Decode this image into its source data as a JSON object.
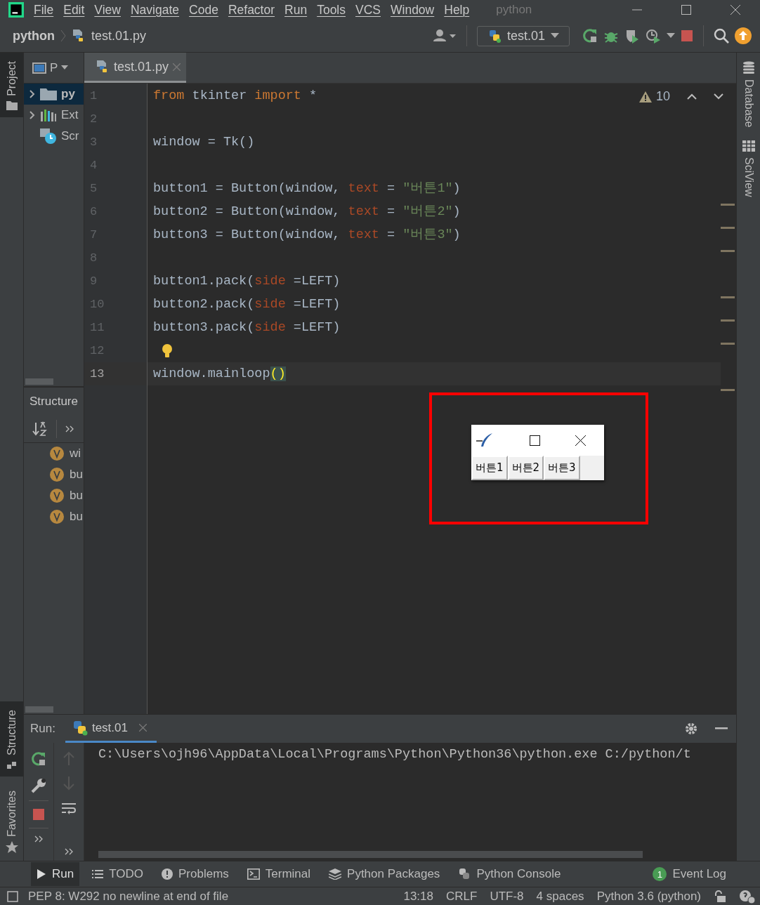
{
  "menu_bar": {
    "items": [
      "File",
      "Edit",
      "View",
      "Navigate",
      "Code",
      "Refactor",
      "Run",
      "Tools",
      "VCS",
      "Window",
      "Help"
    ],
    "project_title": "python"
  },
  "nav_bar": {
    "breadcrumbs": [
      "python",
      "test.01.py"
    ],
    "run_config": "test.01"
  },
  "side_tabs": {
    "left_top": [
      {
        "label": "Project",
        "selected": true
      }
    ],
    "left_bottom": [
      {
        "label": "Structure",
        "selected": true
      },
      {
        "label": "Favorites",
        "selected": false
      }
    ],
    "right": [
      {
        "label": "Database",
        "kind": "database"
      },
      {
        "label": "SciView",
        "kind": "sciview"
      }
    ]
  },
  "project_panel": {
    "tab_label": "P",
    "items": [
      {
        "label": "py",
        "kind": "folder",
        "expanded": false,
        "selected": true
      },
      {
        "label": "Ext",
        "kind": "library",
        "expanded": false,
        "selected": false
      },
      {
        "label": "Scr",
        "kind": "scratches",
        "selected": false
      }
    ]
  },
  "structure_panel": {
    "title": "Structure",
    "items": [
      "wi",
      "bu",
      "bu",
      "bu"
    ]
  },
  "editor": {
    "tab": "test.01.py",
    "warning_count": "10",
    "lines": [
      {
        "number": "1",
        "current": false,
        "tokens": [
          {
            "text": "from",
            "kind": "keyword"
          },
          {
            "text": " tkinter ",
            "kind": "plain"
          },
          {
            "text": "import",
            "kind": "keyword"
          },
          {
            "text": " *",
            "kind": "plain"
          }
        ]
      },
      {
        "number": "2",
        "current": false
      },
      {
        "number": "3",
        "current": false,
        "tokens": [
          {
            "text": "window = Tk()",
            "kind": "plain"
          }
        ]
      },
      {
        "number": "4",
        "current": false
      },
      {
        "number": "5",
        "current": false,
        "tokens": [
          {
            "text": "button1 = Button(window, ",
            "kind": "plain"
          },
          {
            "text": "text",
            "kind": "param"
          },
          {
            "text": " = ",
            "kind": "plain"
          },
          {
            "text": "\"버튼1\"",
            "kind": "string"
          },
          {
            "text": ")",
            "kind": "plain"
          }
        ]
      },
      {
        "number": "6",
        "current": false,
        "tokens": [
          {
            "text": "button2 = Button(window, ",
            "kind": "plain"
          },
          {
            "text": "text",
            "kind": "param"
          },
          {
            "text": " = ",
            "kind": "plain"
          },
          {
            "text": "\"버튼2\"",
            "kind": "string"
          },
          {
            "text": ")",
            "kind": "plain"
          }
        ]
      },
      {
        "number": "7",
        "current": false,
        "tokens": [
          {
            "text": "button3 = Button(window, ",
            "kind": "plain"
          },
          {
            "text": "text",
            "kind": "param"
          },
          {
            "text": " = ",
            "kind": "plain"
          },
          {
            "text": "\"버튼3\"",
            "kind": "string"
          },
          {
            "text": ")",
            "kind": "plain"
          }
        ]
      },
      {
        "number": "8",
        "current": false
      },
      {
        "number": "9",
        "current": false,
        "tokens": [
          {
            "text": "button1.pack(",
            "kind": "plain"
          },
          {
            "text": "side",
            "kind": "param"
          },
          {
            "text": " =LEFT)",
            "kind": "plain"
          }
        ]
      },
      {
        "number": "10",
        "current": false,
        "tokens": [
          {
            "text": "button2.pack(",
            "kind": "plain"
          },
          {
            "text": "side",
            "kind": "param"
          },
          {
            "text": " =LEFT)",
            "kind": "plain"
          }
        ]
      },
      {
        "number": "11",
        "current": false,
        "tokens": [
          {
            "text": "button3.pack(",
            "kind": "plain"
          },
          {
            "text": "side",
            "kind": "param"
          },
          {
            "text": " =LEFT)",
            "kind": "plain"
          }
        ]
      },
      {
        "number": "12",
        "current": false,
        "bulb": true
      },
      {
        "number": "13",
        "current": true,
        "tokens": [
          {
            "text": "window.mainloop",
            "kind": "plain"
          },
          {
            "text": "()",
            "kind": "brace_match"
          }
        ]
      }
    ]
  },
  "tk_window": {
    "buttons": [
      "버튼1",
      "버튼2",
      "버튼3"
    ]
  },
  "run_panel": {
    "label": "Run:",
    "tab": "test.01",
    "output": "C:\\Users\\ojh96\\AppData\\Local\\Programs\\Python\\Python36\\python.exe C:/python/t"
  },
  "tool_windows": [
    {
      "label": "Run",
      "kind": "run",
      "selected": true
    },
    {
      "label": "TODO",
      "kind": "todo",
      "selected": false
    },
    {
      "label": "Problems",
      "kind": "problems",
      "selected": false
    },
    {
      "label": "Terminal",
      "kind": "terminal",
      "selected": false
    },
    {
      "label": "Python Packages",
      "kind": "packages",
      "selected": false
    },
    {
      "label": "Python Console",
      "kind": "console",
      "selected": false
    }
  ],
  "event_log": {
    "label": "Event Log",
    "count": "1"
  },
  "status_bar": {
    "message": "PEP 8: W292 no newline at end of file",
    "items": [
      "13:18",
      "CRLF",
      "UTF-8",
      "4 spaces",
      "Python 3.6 (python)"
    ]
  }
}
